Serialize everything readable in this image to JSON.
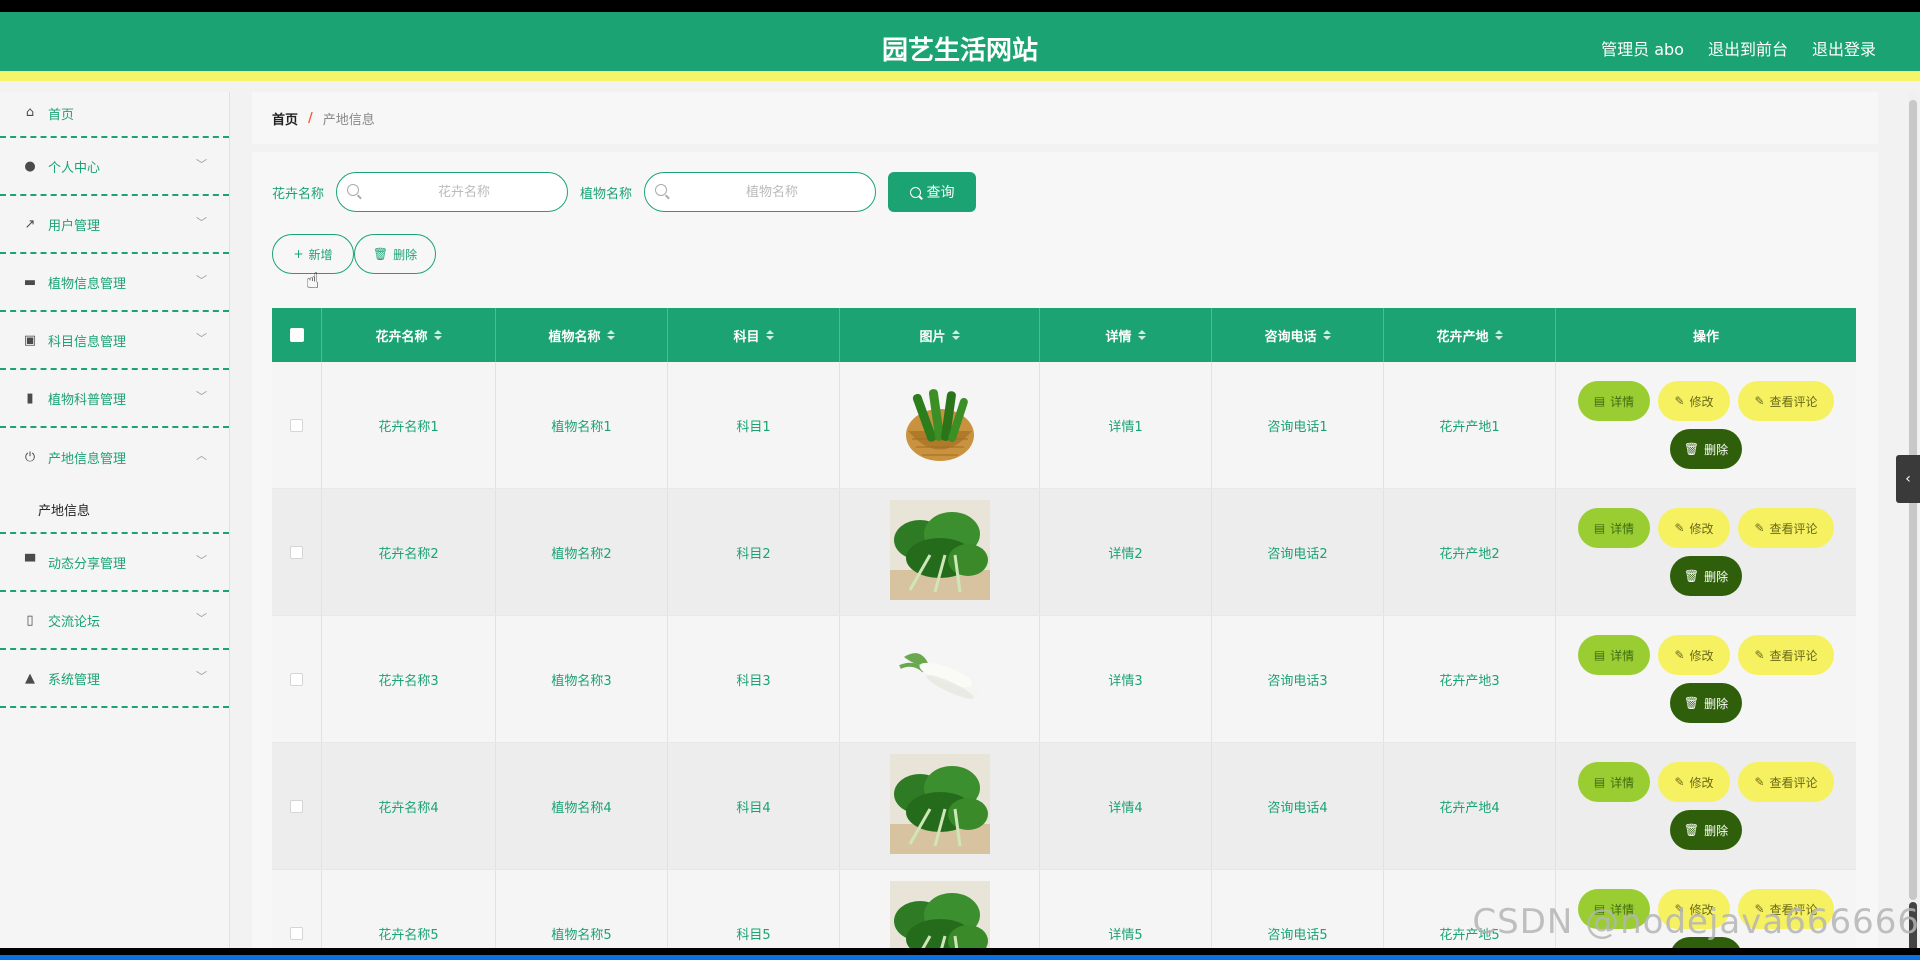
{
  "header": {
    "title": "园艺生活网站",
    "admin": "管理员 abo",
    "front": "退出到前台",
    "logout": "退出登录"
  },
  "sidebar": {
    "items": [
      {
        "label": "首页",
        "icon": "home-icon"
      },
      {
        "label": "个人中心",
        "icon": "user-icon"
      },
      {
        "label": "用户管理",
        "icon": "chart-icon"
      },
      {
        "label": "植物信息管理",
        "icon": "briefcase-icon"
      },
      {
        "label": "科目信息管理",
        "icon": "clipboard-icon"
      },
      {
        "label": "植物科普管理",
        "icon": "bar-chart-icon"
      },
      {
        "label": "产地信息管理",
        "icon": "power-icon"
      },
      {
        "label": "动态分享管理",
        "icon": "brush-icon"
      },
      {
        "label": "交流论坛",
        "icon": "mic-icon"
      },
      {
        "label": "系统管理",
        "icon": "person-icon"
      }
    ],
    "sub_item": "产地信息"
  },
  "breadcrumb": {
    "home": "首页",
    "separator": "/",
    "current": "产地信息"
  },
  "search": {
    "flower_label": "花卉名称",
    "flower_placeholder": "花卉名称",
    "plant_label": "植物名称",
    "plant_placeholder": "植物名称",
    "query_button": "查询"
  },
  "actions": {
    "add": "新增",
    "delete": "删除"
  },
  "table": {
    "headers": [
      "花卉名称",
      "植物名称",
      "科目",
      "图片",
      "详情",
      "咨询电话",
      "花卉产地",
      "操作"
    ],
    "rows": [
      {
        "flower": "花卉名称1",
        "plant": "植物名称1",
        "subject": "科目1",
        "image": "cucumber-basket",
        "detail": "详情1",
        "phone": "咨询电话1",
        "origin": "花卉产地1"
      },
      {
        "flower": "花卉名称2",
        "plant": "植物名称2",
        "subject": "科目2",
        "image": "leafy-greens",
        "detail": "详情2",
        "phone": "咨询电话2",
        "origin": "花卉产地2"
      },
      {
        "flower": "花卉名称3",
        "plant": "植物名称3",
        "subject": "科目3",
        "image": "white-radish",
        "detail": "详情3",
        "phone": "咨询电话3",
        "origin": "花卉产地3"
      },
      {
        "flower": "花卉名称4",
        "plant": "植物名称4",
        "subject": "科目4",
        "image": "leafy-greens",
        "detail": "详情4",
        "phone": "咨询电话4",
        "origin": "花卉产地4"
      },
      {
        "flower": "花卉名称5",
        "plant": "植物名称5",
        "subject": "科目5",
        "image": "leafy-greens",
        "detail": "详情5",
        "phone": "咨询电话5",
        "origin": "花卉产地5"
      }
    ],
    "row_actions": {
      "detail": "详情",
      "edit": "修改",
      "review": "查看评论",
      "delete": "删除"
    }
  },
  "watermark": "CSDN @nodejava666666",
  "colors": {
    "primary": "#1ba373",
    "accent_yellow": "#f6f56a",
    "detail_btn": "#9acd32",
    "delete_btn": "#2f5f0a"
  }
}
